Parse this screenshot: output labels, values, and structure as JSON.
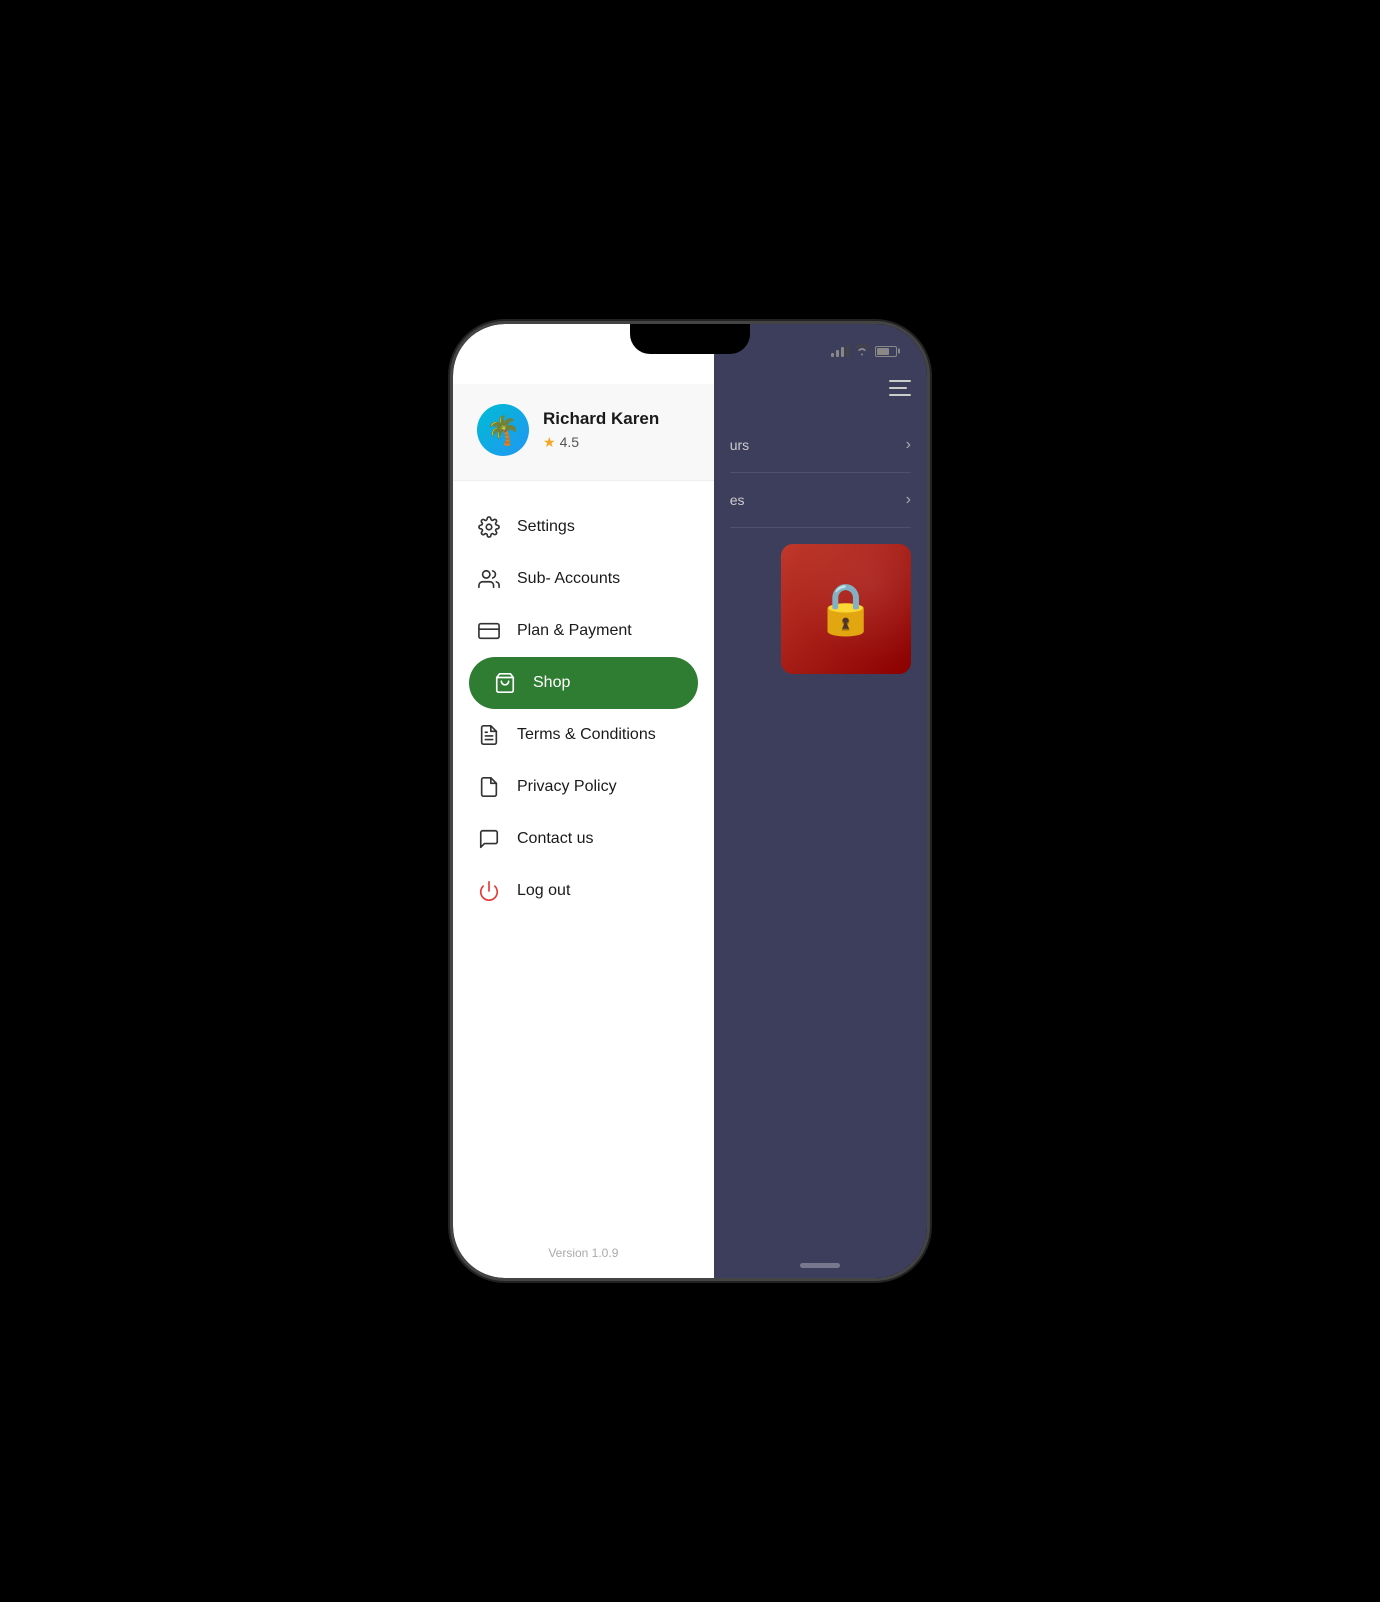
{
  "phone": {
    "statusBar": {
      "batteryLabel": "battery"
    }
  },
  "user": {
    "name": "Richard Karen",
    "rating": "4.5",
    "avatarEmoji": "🌴"
  },
  "menu": {
    "items": [
      {
        "id": "settings",
        "label": "Settings",
        "icon": "gear",
        "active": false
      },
      {
        "id": "sub-accounts",
        "label": "Sub- Accounts",
        "icon": "people",
        "active": false
      },
      {
        "id": "plan-payment",
        "label": "Plan & Payment",
        "icon": "card",
        "active": false
      },
      {
        "id": "shop",
        "label": "Shop",
        "icon": "bag",
        "active": true
      },
      {
        "id": "terms",
        "label": "Terms & Conditions",
        "icon": "document",
        "active": false
      },
      {
        "id": "privacy",
        "label": "Privacy Policy",
        "icon": "file",
        "active": false
      },
      {
        "id": "contact",
        "label": "Contact us",
        "icon": "chat",
        "active": false
      },
      {
        "id": "logout",
        "label": "Log out",
        "icon": "power",
        "active": false
      }
    ]
  },
  "footer": {
    "version": "Version 1.0.9"
  },
  "appBackground": {
    "items": [
      {
        "label": "urs",
        "id": "item-1"
      },
      {
        "label": "es",
        "id": "item-2"
      }
    ]
  }
}
